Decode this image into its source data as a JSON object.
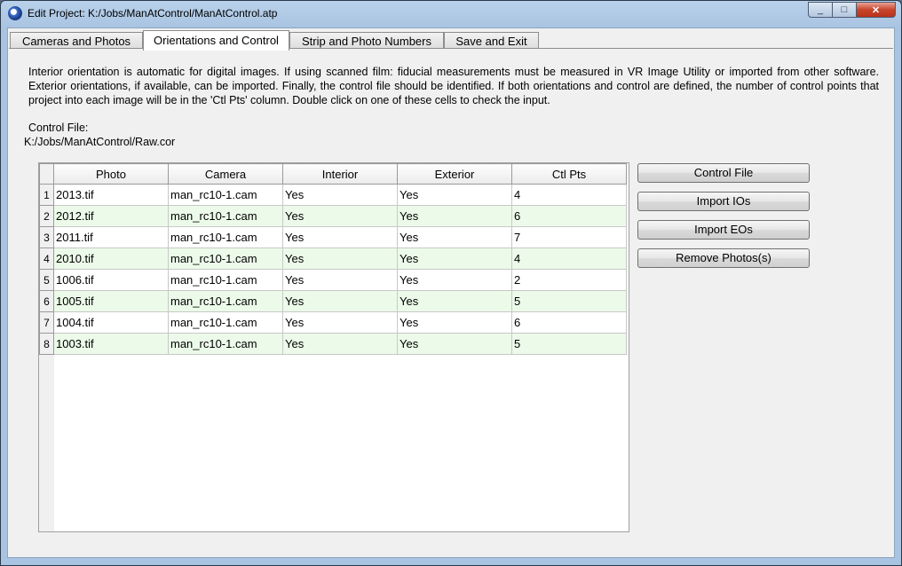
{
  "window": {
    "title": "Edit Project:  K:/Jobs/ManAtControl/ManAtControl.atp",
    "min_glyph": "_",
    "max_glyph": "□",
    "close_glyph": "✕"
  },
  "tabs": [
    {
      "label": "Cameras and Photos"
    },
    {
      "label": "Orientations and Control"
    },
    {
      "label": "Strip and Photo Numbers"
    },
    {
      "label": "Save and Exit"
    }
  ],
  "description": "Interior orientation is automatic for digital images.  If using scanned film: fiducial measurements must be measured in VR Image Utility or imported from other software.  Exterior orientations, if available, can be imported.  Finally, the control file should be identified.  If both orientations and control are defined, the number of control points that project into each image will be in the 'Ctl Pts' column.  Double click on one of these cells to check the input.",
  "control_file": {
    "label": "Control File:",
    "path": "K:/Jobs/ManAtControl/Raw.cor"
  },
  "table": {
    "columns": [
      "Photo",
      "Camera",
      "Interior",
      "Exterior",
      "Ctl Pts"
    ],
    "rows": [
      {
        "num": "1",
        "photo": "2013.tif",
        "camera": "man_rc10-1.cam",
        "interior": "Yes",
        "exterior": "Yes",
        "ctl": "4"
      },
      {
        "num": "2",
        "photo": "2012.tif",
        "camera": "man_rc10-1.cam",
        "interior": "Yes",
        "exterior": "Yes",
        "ctl": "6"
      },
      {
        "num": "3",
        "photo": "2011.tif",
        "camera": "man_rc10-1.cam",
        "interior": "Yes",
        "exterior": "Yes",
        "ctl": "7"
      },
      {
        "num": "4",
        "photo": "2010.tif",
        "camera": "man_rc10-1.cam",
        "interior": "Yes",
        "exterior": "Yes",
        "ctl": "4"
      },
      {
        "num": "5",
        "photo": "1006.tif",
        "camera": "man_rc10-1.cam",
        "interior": "Yes",
        "exterior": "Yes",
        "ctl": "2"
      },
      {
        "num": "6",
        "photo": "1005.tif",
        "camera": "man_rc10-1.cam",
        "interior": "Yes",
        "exterior": "Yes",
        "ctl": "5"
      },
      {
        "num": "7",
        "photo": "1004.tif",
        "camera": "man_rc10-1.cam",
        "interior": "Yes",
        "exterior": "Yes",
        "ctl": "6"
      },
      {
        "num": "8",
        "photo": "1003.tif",
        "camera": "man_rc10-1.cam",
        "interior": "Yes",
        "exterior": "Yes",
        "ctl": "5"
      }
    ]
  },
  "buttons": {
    "control_file": "Control File",
    "import_ios": "Import IOs",
    "import_eos": "Import EOs",
    "remove_photos": "Remove Photos(s)"
  },
  "colors": {
    "alt_row": "#ecfbe9",
    "titlebar": "#b9d1ea",
    "close_button": "#c8452b"
  }
}
